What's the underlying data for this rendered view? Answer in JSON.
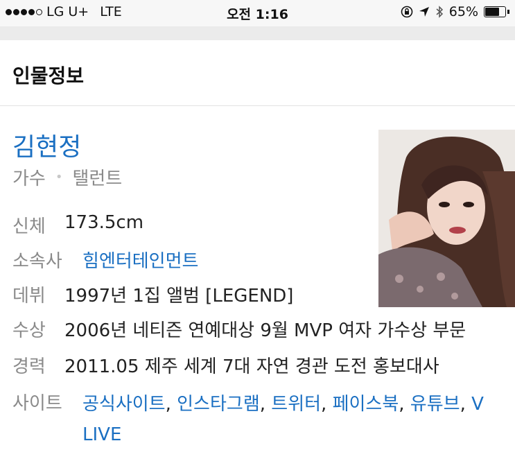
{
  "status": {
    "carrier": "LG U+",
    "network": "LTE",
    "time": "오전 1:16",
    "battery": "65%",
    "battery_level": 0.65,
    "signal_bars_filled": 4,
    "signal_bars_total": 5
  },
  "header": {
    "title": "인물정보"
  },
  "person": {
    "name": "김현정",
    "roles": [
      "가수",
      "탤런트"
    ],
    "rows": [
      {
        "label": "신체",
        "value": "173.5cm",
        "is_link": false
      },
      {
        "label": "소속사",
        "value": "힘엔터테인먼트",
        "is_link": true
      },
      {
        "label": "데뷔",
        "value": "1997년 1집 앨범 [LEGEND]",
        "is_link": false
      },
      {
        "label": "수상",
        "value": "2006년 네티즌 연예대상 9월 MVP 여자 가수상 부문",
        "is_link": false
      },
      {
        "label": "경력",
        "value": "2011.05 제주 세계 7대 자연 경관 도전 홍보대사",
        "is_link": false
      }
    ],
    "sites_label": "사이트",
    "sites": [
      "공식사이트",
      "인스타그램",
      "트위터",
      "페이스북",
      "유튜브",
      "V LIVE"
    ]
  },
  "colors": {
    "link": "#1a6fc2",
    "label": "#8a8a8a",
    "text": "#222222"
  }
}
